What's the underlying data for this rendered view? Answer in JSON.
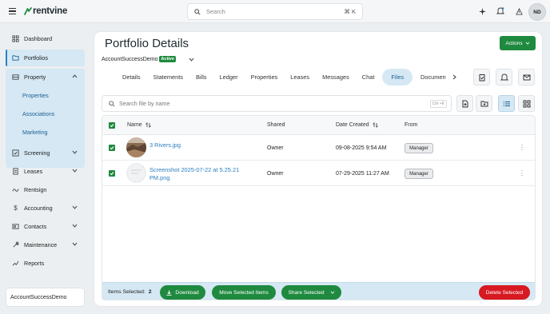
{
  "topbar": {
    "brand": "rentvine",
    "search_placeholder": "Search",
    "search_shortcut": "⌘ K",
    "user_initials": "ND"
  },
  "sidebar": {
    "items": [
      {
        "label": "Dashboard",
        "icon": "dashboard-icon"
      },
      {
        "label": "Portfolios",
        "icon": "portfolio-icon",
        "active": true
      },
      {
        "label": "Property",
        "icon": "property-icon",
        "expanded": true
      },
      {
        "label": "Screening",
        "icon": "screening-icon"
      },
      {
        "label": "Leases",
        "icon": "leases-icon"
      },
      {
        "label": "Rentsign",
        "icon": "rentsign-icon"
      },
      {
        "label": "Accounting",
        "icon": "dollar-icon"
      },
      {
        "label": "Contacts",
        "icon": "contacts-icon"
      },
      {
        "label": "Maintenance",
        "icon": "wrench-icon"
      },
      {
        "label": "Reports",
        "icon": "reports-icon"
      }
    ],
    "property_sub": [
      "Properties",
      "Associations",
      "Marketing"
    ],
    "org_name": "AccountSuccessDemo"
  },
  "main": {
    "title": "Portfolio Details",
    "actions_label": "Actions",
    "account_name": "AccountSuccessDemo",
    "account_status": "Active",
    "tabs": [
      "Details",
      "Statements",
      "Bills",
      "Ledger",
      "Properties",
      "Leases",
      "Messages",
      "Chat",
      "Files",
      "Documents"
    ],
    "active_tab": "Files",
    "file_search_placeholder": "Search file by name",
    "file_search_shortcut": "Ctrl +K"
  },
  "table": {
    "headers": {
      "name": "Name",
      "shared": "Shared",
      "date_created": "Date Created",
      "from": "From"
    },
    "rows": [
      {
        "name": "3 Rivers.jpg",
        "shared": "Owner",
        "date": "09-08-2025 9:54 AM",
        "from": "Manager",
        "checked": true
      },
      {
        "name": "Screenshot 2025-07-22 at 5.25.21 PM.png",
        "shared": "Owner",
        "date": "07-29-2025 11:27 AM",
        "from": "Manager",
        "checked": true
      }
    ]
  },
  "footer": {
    "items_selected_label": "Items Selected:",
    "items_selected_count": "2",
    "download_label": "Download",
    "move_label": "Move Selected Items",
    "share_label": "Share Selected",
    "delete_label": "Delete Selected"
  },
  "colors": {
    "brand_green": "#1f8a3f",
    "active_blue": "#d5e8f4",
    "link_blue": "#2a7ec0",
    "danger_red": "#d71921"
  }
}
